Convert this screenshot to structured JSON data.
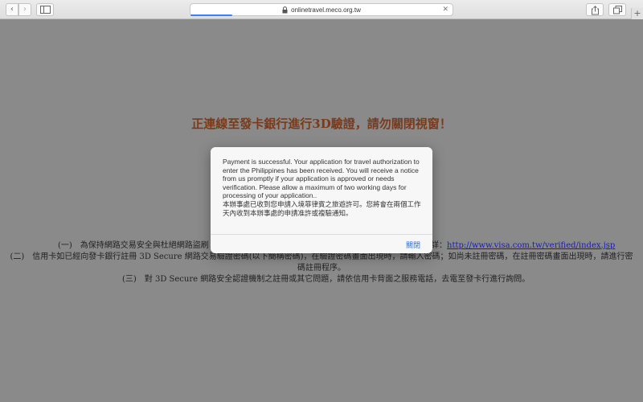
{
  "browser": {
    "url": "onlinetravel.meco.org.tw",
    "back_icon": "chevron-left-icon",
    "forward_icon": "chevron-right-icon",
    "newtab_label": "+",
    "close_label": "✕",
    "loading_progress": 0.16
  },
  "page": {
    "heading": "正連線至發卡銀行進行3D驗證，請勿關閉視窗！",
    "line1_start": "(一)　為保持網路交易安全與杜絕網路盜刷",
    "line1_end": "詳：",
    "line1_link": "http://www.visa.com.tw/verified/index.jsp",
    "line2": "(二)　信用卡如已經向發卡銀行註冊 3D Secure 網路交易驗證密碼(以下簡稱密碼)，在驗證密碼畫面出現時，請輸入密碼；如尚未註冊密碼，在註冊密碼畫面出現時，請進行密碼註冊程序。",
    "line3": "(三)　對 3D Secure 網路安全認證機制之註冊或其它問題，請依信用卡背面之服務電話，去電至發卡行進行詢問。"
  },
  "dialog": {
    "message_en": "Payment is successful. Your application for travel authorization to enter the Philippines has been received. You will receive a notice from us promptly if your application is approved or needs verification. Please allow a maximum of two working days for processing of your application..",
    "message_zh": "本辦事處已收到您申請入境菲律賓之旅遊許可。您將會在兩個工作天內收到本辦事處的申請准許或複驗通知。",
    "close_button": "關閉"
  }
}
